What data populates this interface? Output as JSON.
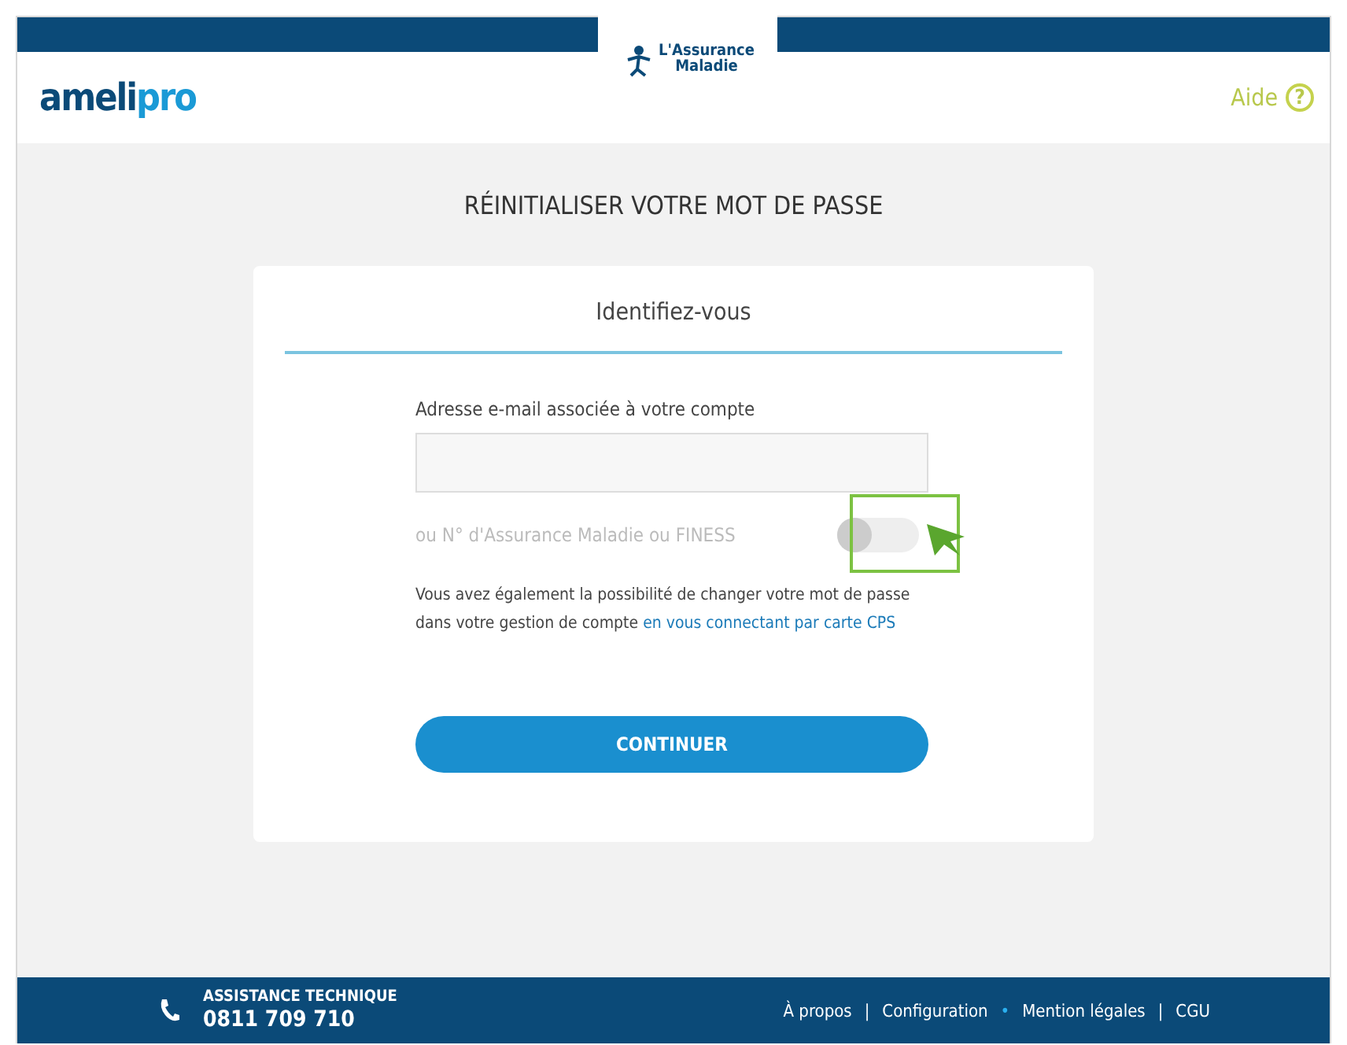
{
  "header": {
    "logo": "ameli",
    "logo_accent": "pro",
    "partner_logo_line1": "L'Assurance",
    "partner_logo_line2": "Maladie",
    "help": "Aide",
    "help_icon": "?"
  },
  "page_title": "RÉINITIALISER VOTRE MOT DE PASSE",
  "card": {
    "title": "Identifiez-vous",
    "email_label": "Adresse e-mail associée à votre compte",
    "alt_label": "ou N° d'Assurance Maladie ou FINESS",
    "toggle": {
      "on": false,
      "highlighted": true
    },
    "info_text": "Vous avez également la possibilité de changer votre mot de passe dans votre gestion de compte ",
    "info_link": "en vous connectant par carte CPS",
    "button": "CONTINUER"
  },
  "footer": {
    "support_title": "ASSISTANCE TECHNIQUE",
    "phone": "0811 709 710",
    "links": [
      {
        "label": "À propos",
        "separator": "|"
      },
      {
        "label": "Configuration",
        "separator": "•"
      },
      {
        "label": "Mention légales",
        "separator": "|"
      },
      {
        "label": "CGU"
      }
    ]
  }
}
